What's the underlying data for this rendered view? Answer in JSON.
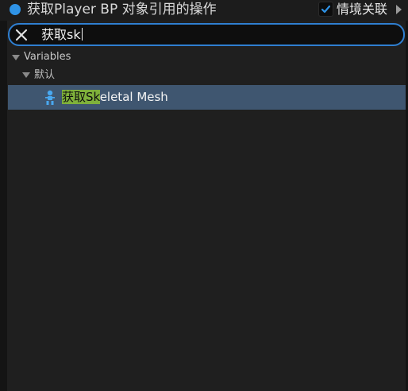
{
  "header": {
    "title": "获取Player BP 对象引用的操作",
    "context_sensitive_label": "情境关联",
    "context_sensitive_checked": true
  },
  "search": {
    "query": "获取sk"
  },
  "tree": {
    "category": "Variables",
    "subcategory": "默认",
    "items": [
      {
        "match": "获取Sk",
        "rest": "eletal Mesh"
      }
    ]
  },
  "colors": {
    "accent": "#2f7fd1",
    "highlight": "#7fb13b",
    "selected_row": "#3f5670",
    "dot": "#2f93e6"
  }
}
